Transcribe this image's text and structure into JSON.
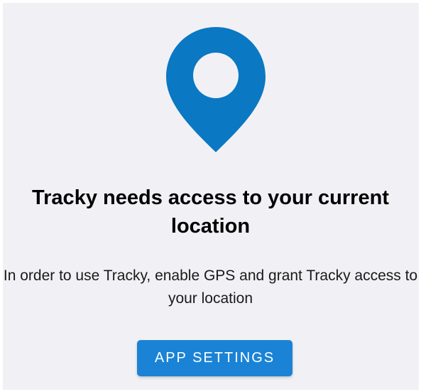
{
  "permission_screen": {
    "icon": "location-pin-icon",
    "title": "Tracky needs access to your current location",
    "message": "In order to use Tracky, enable GPS and grant Tracky access to your location",
    "button_label": "APP SETTINGS"
  },
  "colors": {
    "background": "#f1f1f5",
    "accent": "#0a78c2",
    "button": "#1a83d6",
    "button_text": "#ffffff",
    "title_text": "#000000"
  }
}
